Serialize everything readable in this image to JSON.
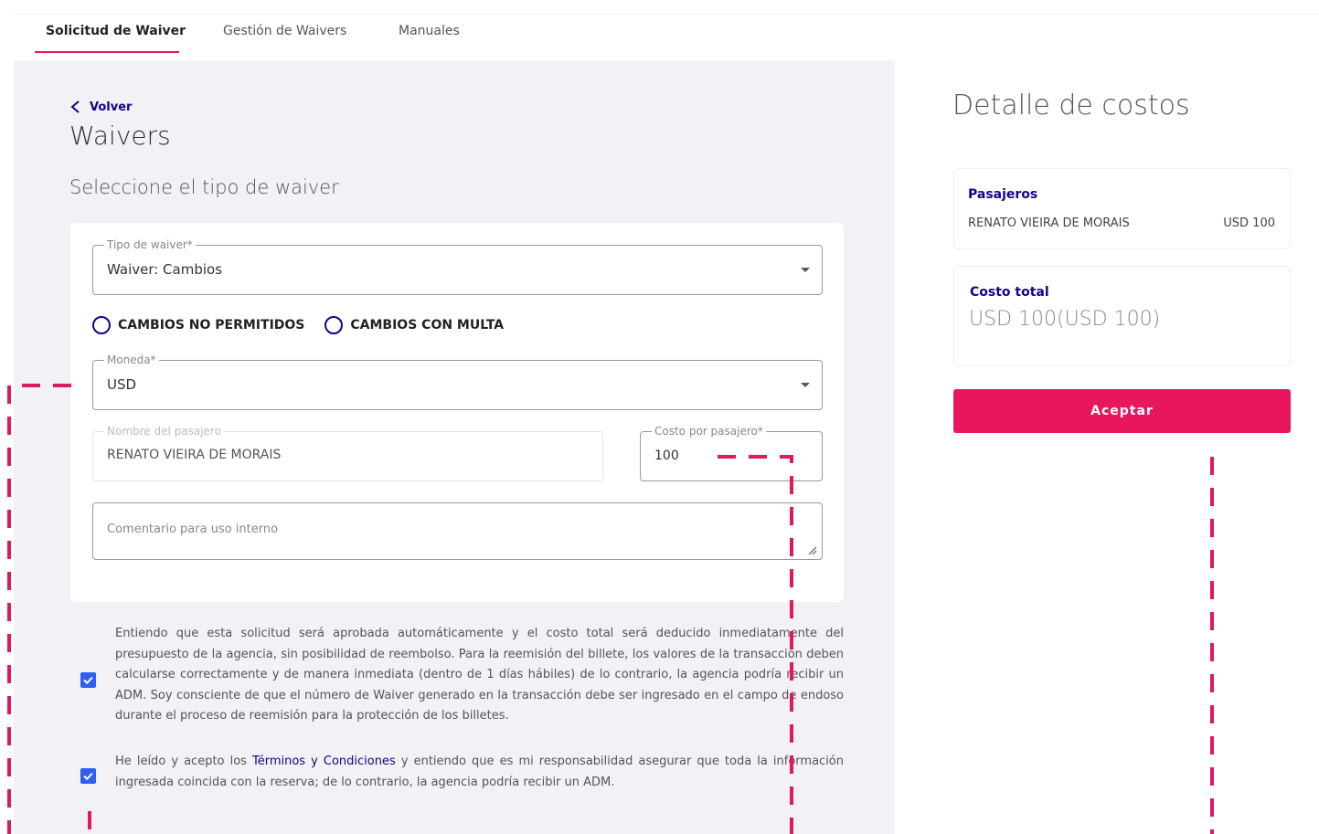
{
  "nav": {
    "tabs": [
      {
        "label": "Solicitud de Waiver",
        "active": true
      },
      {
        "label": "Gestión de Waivers",
        "active": false
      },
      {
        "label": "Manuales",
        "active": false
      }
    ]
  },
  "main": {
    "back_label": "Volver",
    "title": "Waivers",
    "section_title": "Seleccione el tipo de waiver",
    "waiver_type": {
      "legend": "Tipo de waiver*",
      "value": "Waiver: Cambios"
    },
    "radios": [
      {
        "label": "CAMBIOS NO PERMITIDOS",
        "checked": false
      },
      {
        "label": "CAMBIOS CON MULTA",
        "checked": false
      }
    ],
    "currency": {
      "legend": "Moneda*",
      "value": "USD"
    },
    "passenger_name": {
      "legend": "Nombre del pasajero",
      "value": "RENATO VIEIRA DE MORAIS"
    },
    "cost_per_passenger": {
      "legend": "Costo por pasajero*",
      "value": "100"
    },
    "comment": {
      "placeholder": "Comentario para uso interno"
    },
    "agreements": [
      {
        "checked": true,
        "text": "Entiendo que esta solicitud será aprobada automáticamente y el costo total será deducido inmediatamente del presupuesto de la agencia, sin posibilidad de reembolso. Para la reemisión del billete, los valores de la transacción deben calcularse correctamente y de manera inmediata (dentro de 1 días hábiles) de lo contrario, la agencia podría recibir un ADM. Soy consciente de que el número de Waiver generado en la transacción debe ser ingresado en el campo de endoso durante el proceso de reemisión para la protección de los billetes."
      },
      {
        "checked": true,
        "text_before": "He leído y acepto los ",
        "link": "Términos y Condiciones",
        "text_after": " y entiendo que es mi responsabilidad asegurar que toda la información ingresada coincida con la reserva; de lo contrario, la agencia podría recibir un ADM."
      }
    ]
  },
  "costs": {
    "title": "Detalle de costos",
    "passengers_title": "Pasajeros",
    "passenger_name": "RENATO VIEIRA DE MORAIS",
    "passenger_amount": "USD 100",
    "total_title": "Costo total",
    "total_value": "USD 100(USD 100)",
    "accept_label": "Aceptar"
  },
  "colors": {
    "accent": "#e8175d",
    "brand": "#1b0088",
    "checkbox": "#2e5ff2",
    "panel_bg": "#f1f1f6"
  }
}
